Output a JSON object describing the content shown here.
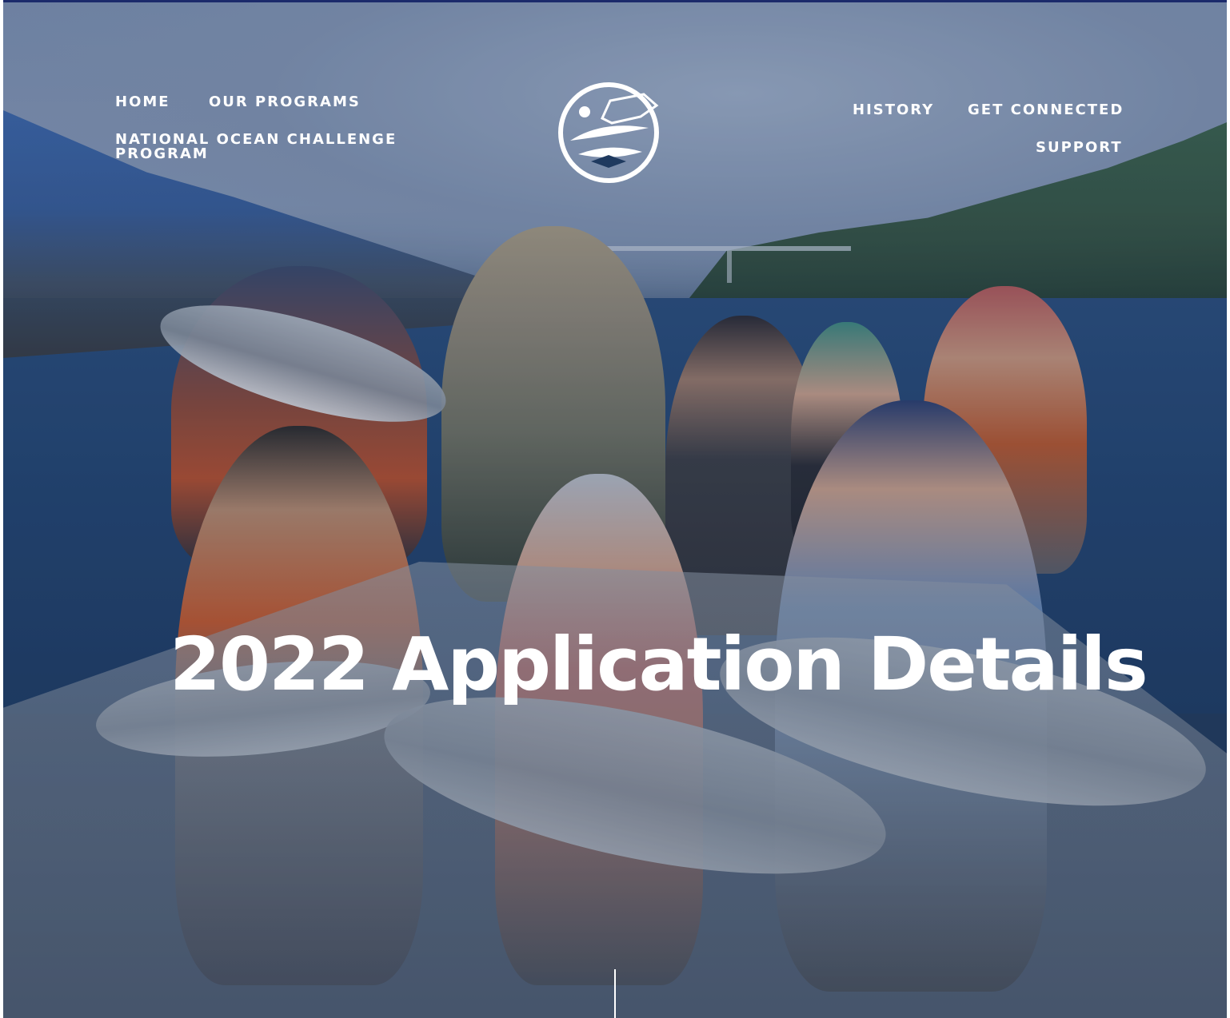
{
  "header": {
    "nav_left": [
      {
        "label": "HOME"
      },
      {
        "label": "OUR PROGRAMS"
      },
      {
        "label": "NATIONAL OCEAN CHALLENGE PROGRAM"
      }
    ],
    "nav_right": [
      {
        "label": "HISTORY"
      },
      {
        "label": "GET CONNECTED"
      },
      {
        "label": "SUPPORT"
      }
    ],
    "logo_icon": "fish-circle-logo"
  },
  "hero": {
    "title": "2022 Application Details",
    "scroll_indicator_icon": "scroll-line-indicator"
  },
  "colors": {
    "overlay": "#1c2f55",
    "text": "#ffffff",
    "top_border": "#1b2a6b"
  }
}
